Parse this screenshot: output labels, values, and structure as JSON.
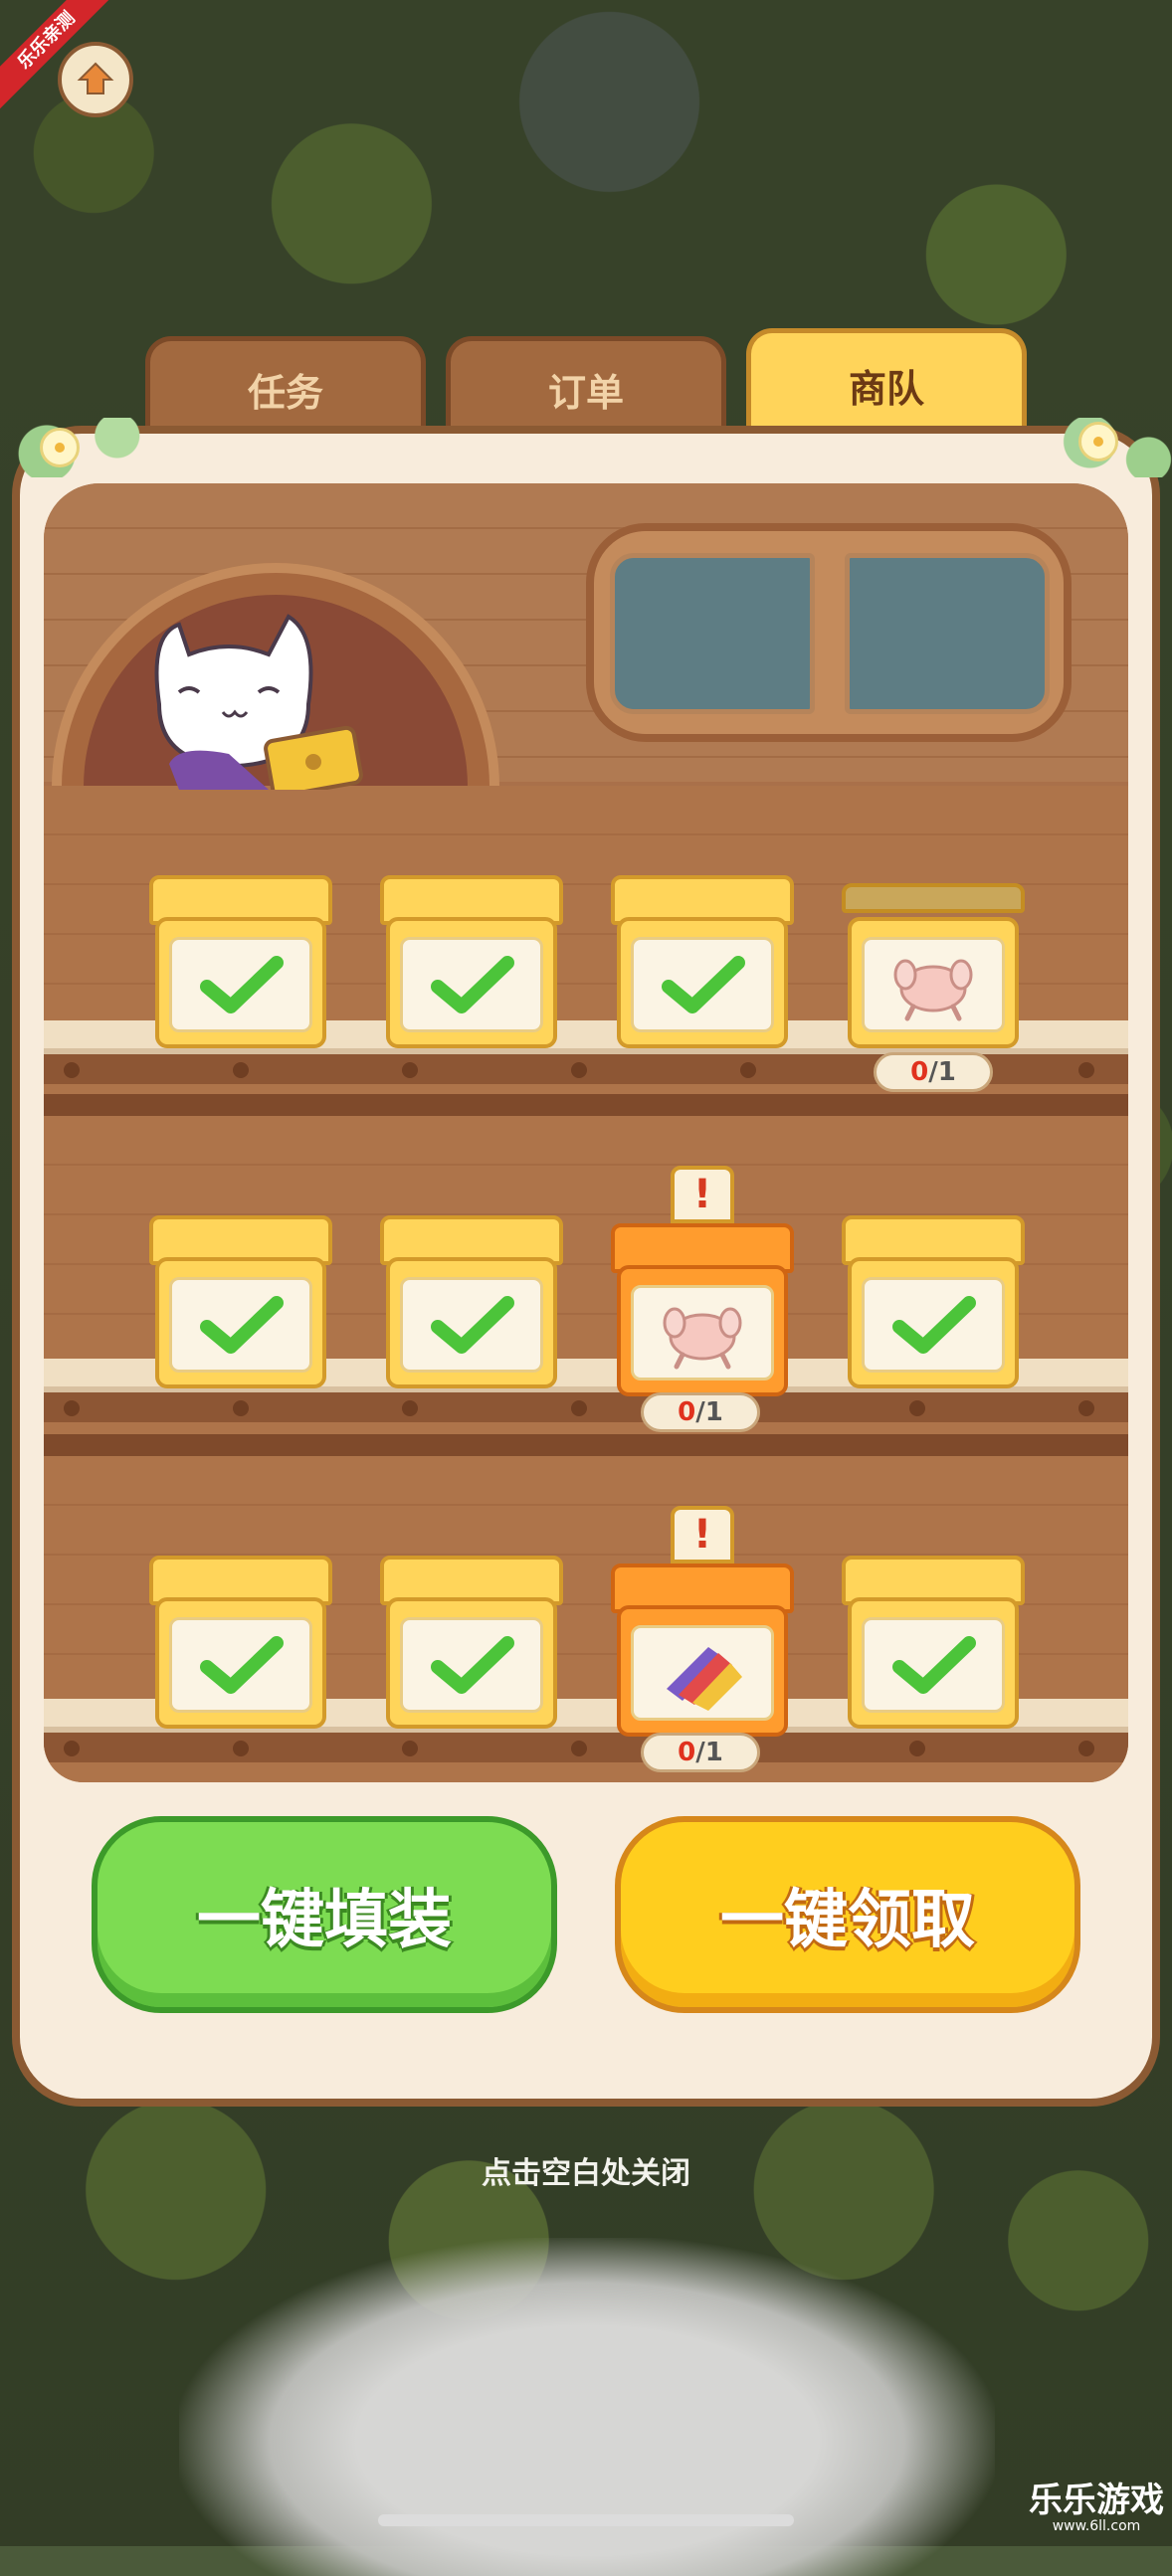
{
  "ribbon": {
    "label": "乐乐亲测"
  },
  "tabs": [
    {
      "label": "任务",
      "active": false
    },
    {
      "label": "订单",
      "active": false
    },
    {
      "label": "商队",
      "active": true
    }
  ],
  "shelves": [
    {
      "boxes": [
        {
          "state": "filled",
          "icon": "check-icon"
        },
        {
          "state": "filled",
          "icon": "check-icon"
        },
        {
          "state": "filled",
          "icon": "check-icon"
        },
        {
          "state": "pending",
          "icon": "chicken-icon",
          "count_have": "0",
          "count_need": "/1"
        }
      ]
    },
    {
      "boxes": [
        {
          "state": "filled",
          "icon": "check-icon"
        },
        {
          "state": "filled",
          "icon": "check-icon"
        },
        {
          "state": "urgent",
          "icon": "chicken-icon",
          "alert": "!",
          "count_have": "0",
          "count_need": "/1"
        },
        {
          "state": "filled",
          "icon": "check-icon"
        }
      ]
    },
    {
      "boxes": [
        {
          "state": "filled",
          "icon": "check-icon"
        },
        {
          "state": "filled",
          "icon": "check-icon"
        },
        {
          "state": "urgent",
          "icon": "fabric-roll-icon",
          "alert": "!",
          "count_have": "0",
          "count_need": "/1"
        },
        {
          "state": "filled",
          "icon": "check-icon"
        }
      ]
    }
  ],
  "buttons": {
    "fill_all": "一键填装",
    "claim_all": "一键领取"
  },
  "close_hint": "点击空白处关闭",
  "watermark": {
    "title": "乐乐游戏",
    "url": "www.6ll.com"
  },
  "colors": {
    "accent_green": "#7ddc52",
    "accent_yellow": "#ffce1e",
    "box_yellow": "#ffd55a",
    "box_orange": "#ff9c2e",
    "wood": "#a9704a"
  }
}
